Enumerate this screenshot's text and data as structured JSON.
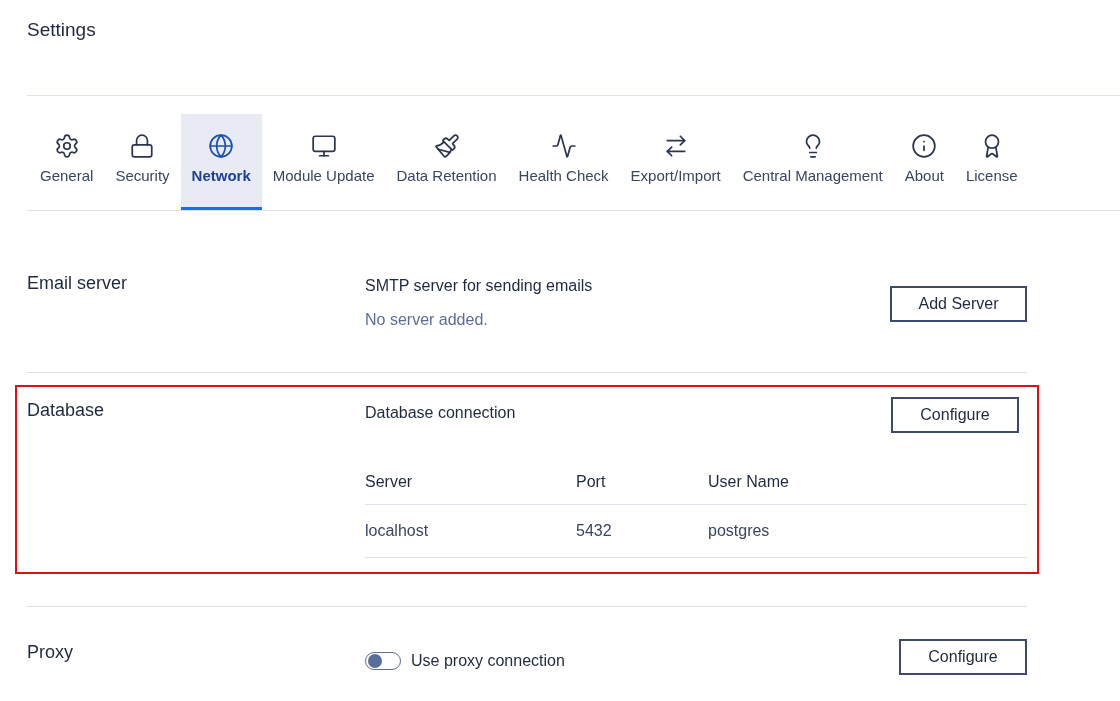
{
  "page": {
    "title": "Settings"
  },
  "tabs": [
    {
      "label": "General",
      "selected": false
    },
    {
      "label": "Security",
      "selected": false
    },
    {
      "label": "Network",
      "selected": true
    },
    {
      "label": "Module Update",
      "selected": false
    },
    {
      "label": "Data Retention",
      "selected": false
    },
    {
      "label": "Health Check",
      "selected": false
    },
    {
      "label": "Export/Import",
      "selected": false
    },
    {
      "label": "Central Management",
      "selected": false
    },
    {
      "label": "About",
      "selected": false
    },
    {
      "label": "License",
      "selected": false
    }
  ],
  "sections": [
    {
      "kind": "empty",
      "label": "Email server",
      "highlighted": false,
      "heading": "SMTP server for sending emails",
      "message": "No server added.",
      "button": "Add Server"
    },
    {
      "kind": "table",
      "label": "Database",
      "highlighted": true,
      "heading": "Database connection",
      "button": "Configure",
      "columns": [
        "Server",
        "Port",
        "User Name"
      ],
      "rows": [
        [
          "localhost",
          "5432",
          "postgres"
        ]
      ]
    },
    {
      "kind": "toggle",
      "label": "Proxy",
      "highlighted": false,
      "toggle": {
        "label": "Use proxy connection",
        "on": false
      },
      "button": "Configure"
    }
  ]
}
